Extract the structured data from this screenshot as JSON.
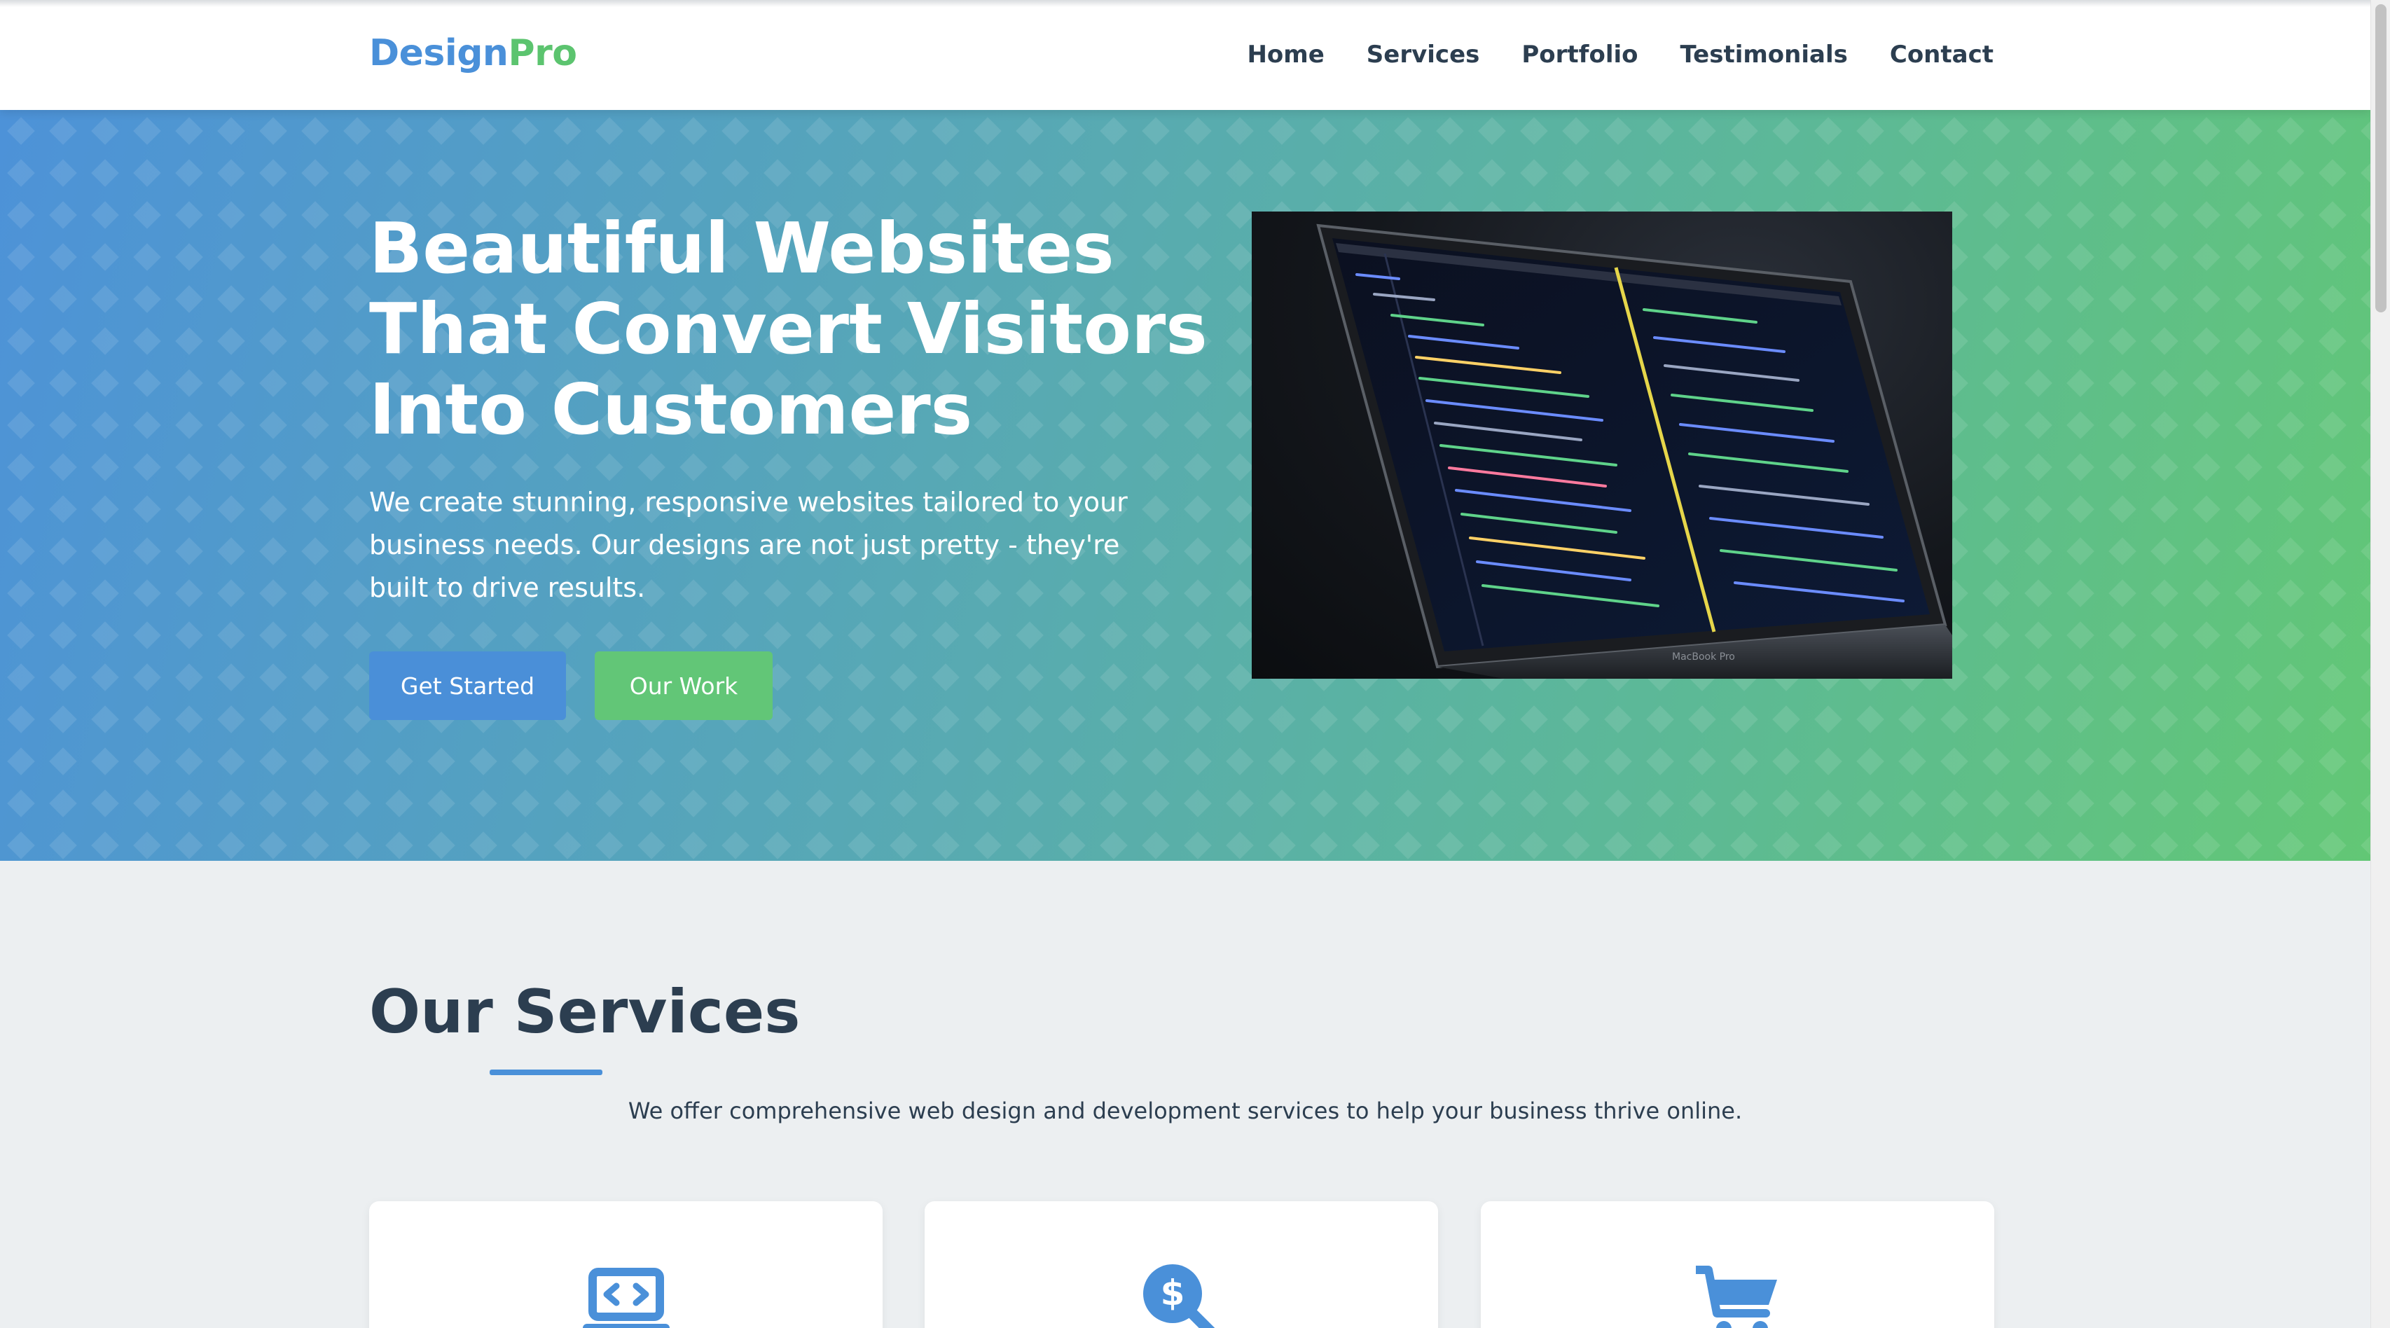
{
  "header": {
    "logo_primary": "Design",
    "logo_accent": "Pro",
    "nav": [
      "Home",
      "Services",
      "Portfolio",
      "Testimonials",
      "Contact"
    ]
  },
  "hero": {
    "title": "Beautiful Websites That Convert Visitors Into Customers",
    "subtitle": "We create stunning, responsive websites tailored to your business needs. Our designs are not just pretty - they're built to drive results.",
    "primary_button": "Get Started",
    "secondary_button": "Our Work",
    "image_caption": "MacBook Pro"
  },
  "services": {
    "title": "Our Services",
    "intro": "We offer comprehensive web design and development services to help your business thrive online.",
    "cards": [
      {
        "icon": "laptop-code-icon"
      },
      {
        "icon": "search-dollar-icon"
      },
      {
        "icon": "shopping-cart-icon"
      }
    ]
  },
  "colors": {
    "primary": "#4a90d9",
    "accent": "#5cc46f",
    "text": "#2c3e50",
    "section_bg": "#eceff1"
  }
}
